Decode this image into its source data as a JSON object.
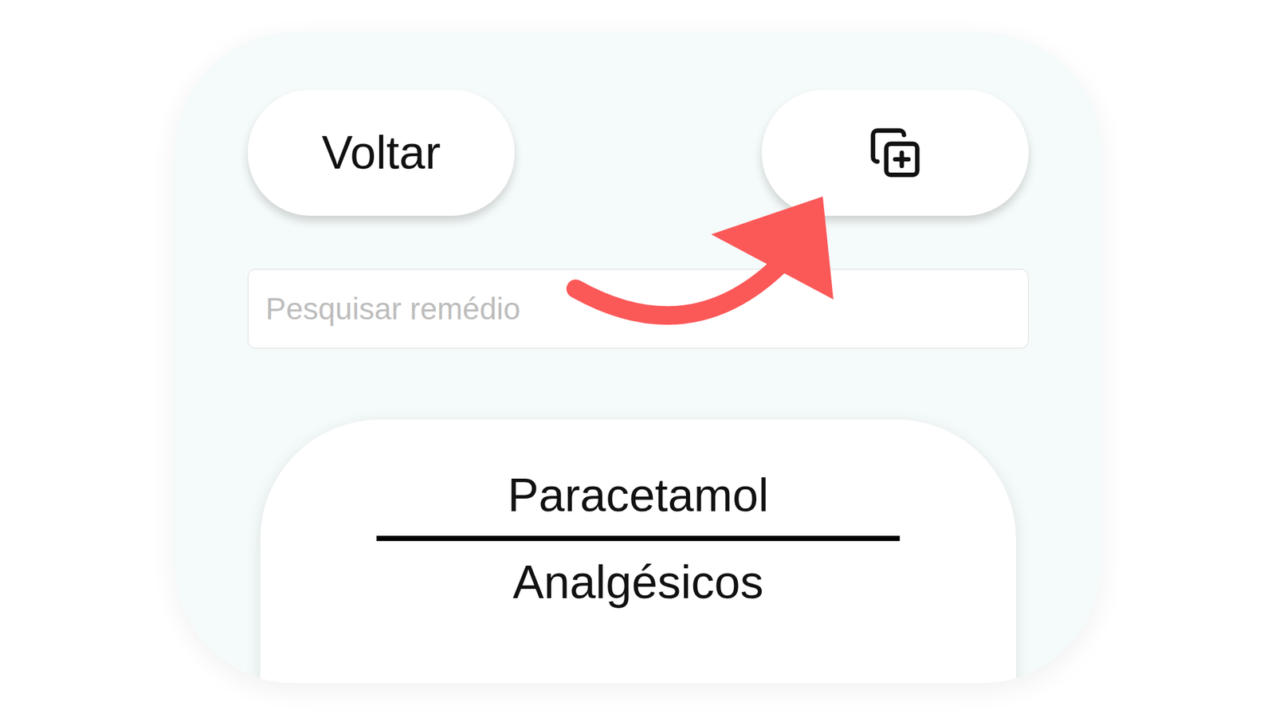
{
  "buttons": {
    "back": "Voltar"
  },
  "search": {
    "placeholder": "Pesquisar remédio"
  },
  "medicines": [
    {
      "name": "Paracetamol",
      "category": "Analgésicos"
    }
  ]
}
